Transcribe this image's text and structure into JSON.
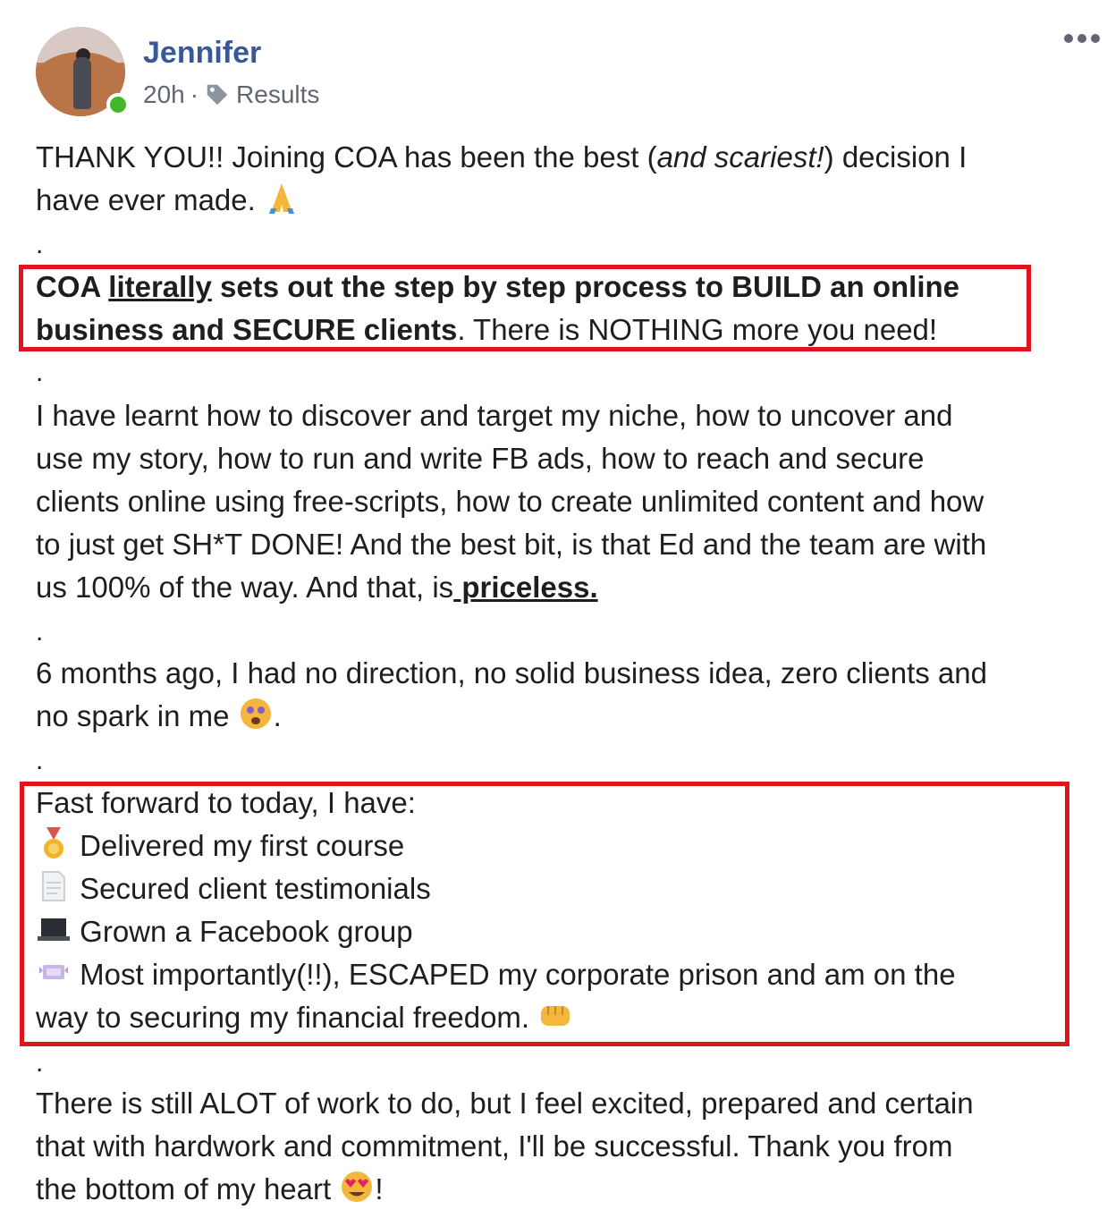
{
  "post": {
    "author": "Jennifer",
    "time": "20h",
    "separator": "·",
    "tag": "Results",
    "icons": {
      "more": "more-options-icon",
      "tag": "tag-icon",
      "online": "online-status-dot"
    },
    "accent": "#385898",
    "highlight_color": "#e0141e"
  },
  "body": {
    "p1": {
      "a": "THANK YOU!! Joining COA has been the best (",
      "b": "and scariest!",
      "c": ") decision I",
      "d": "have ever made."
    },
    "dot": ".",
    "p2": {
      "a": "COA ",
      "b": "literally",
      "c": " sets out the step by step process to BUILD an online",
      "d": "business and SECURE clients",
      "e": ". There is NOTHING more you need!"
    },
    "p3": {
      "l1": "I have learnt how to discover and target my niche, how to uncover and",
      "l2": "use my story, how to run and write FB ads, how to reach and secure",
      "l3": "clients online using free-scripts, how to create unlimited content and how",
      "l4": "to just get SH*T DONE! And the best bit, is that Ed and the team are with",
      "l5a": "us 100% of the way. And that, is",
      "l5b": " priceless."
    },
    "p4": {
      "l1": "6 months ago, I had no direction, no solid business idea, zero clients and",
      "l2": "no spark in me",
      "l2end": "."
    },
    "p5": {
      "intro": "Fast forward to today, I have:",
      "items": [
        "Delivered my first course",
        " Secured client testimonials",
        "Grown a Facebook group",
        "Most importantly(!!), ESCAPED my corporate prison and am on the"
      ],
      "last": "way to securing my financial freedom."
    },
    "p6": {
      "l1": "There is still ALOT of work to do, but I feel excited, prepared and certain",
      "l2": "that with hardwork and commitment, I'll be successful. Thank you from",
      "l3": "the bottom of my heart",
      "l3end": "!"
    }
  }
}
